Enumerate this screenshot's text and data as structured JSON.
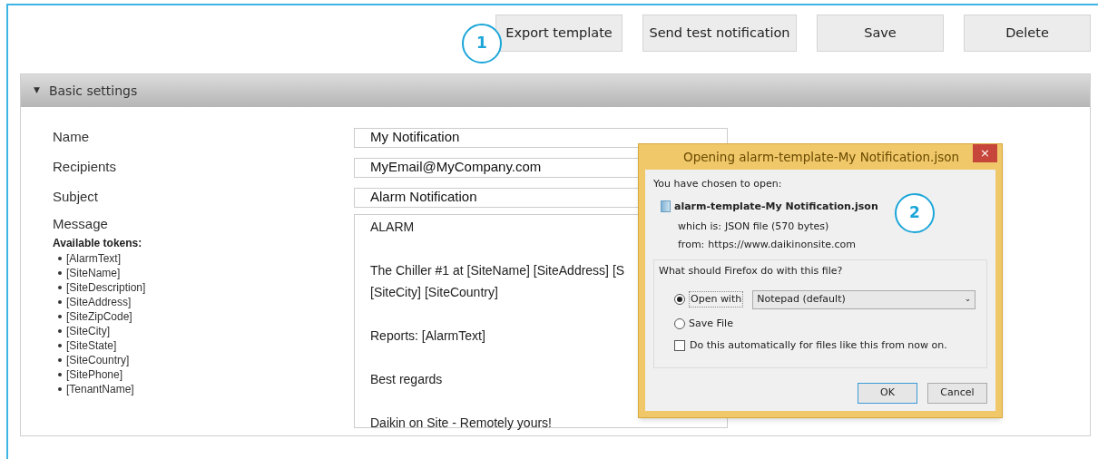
{
  "toolbar": {
    "buttons": [
      "Export template",
      "Send test notification",
      "Save",
      "Delete"
    ]
  },
  "callouts": [
    "1",
    "2"
  ],
  "section": {
    "title": "Basic settings",
    "caret": "▼",
    "expanded": true
  },
  "fields": [
    {
      "label": "Name",
      "value": "My Notification"
    },
    {
      "label": "Recipients",
      "value": "MyEmail@MyCompany.com"
    },
    {
      "label": "Subject",
      "value": "Alarm Notification"
    }
  ],
  "message": {
    "label": "Message",
    "tokens_title": "Available tokens:",
    "tokens": [
      "[AlarmText]",
      "[SiteName]",
      "[SiteDescription]",
      "[SiteAddress]",
      "[SiteZipCode]",
      "[SiteCity]",
      "[SiteState]",
      "[SiteCountry]",
      "[SitePhone]",
      "[TenantName]"
    ],
    "paragraphs": [
      {
        "lines": [
          "ALARM"
        ]
      },
      {
        "lines": [
          "The Chiller #1 at [SiteName] [SiteAddress] [S",
          "[SiteCity] [SiteCountry]"
        ]
      },
      {
        "lines": [
          "Reports: [AlarmText]"
        ]
      },
      {
        "lines": [
          "Best regards"
        ]
      },
      {
        "lines": [
          "Daikin on Site - Remotely yours!"
        ]
      }
    ]
  },
  "dialog": {
    "title": "Opening alarm-template-My Notification.json",
    "close": "×",
    "intro": "You have chosen to open:",
    "file_name": "alarm-template-My Notification.json",
    "which_is_label": "which is:",
    "which_is": "JSON file (570 bytes)",
    "from_label": "from:",
    "from": "https://www.daikinonsite.com",
    "question": "What should Firefox do with this file?",
    "options": [
      {
        "label": "Open with",
        "selected": true
      },
      {
        "label": "Save File",
        "selected": false
      }
    ],
    "app": "Notepad (default)",
    "app_caret": "⌄",
    "auto": {
      "label": "Do this automatically for files like this from now on.",
      "checked": false
    },
    "buttons": [
      "OK",
      "Cancel"
    ]
  }
}
